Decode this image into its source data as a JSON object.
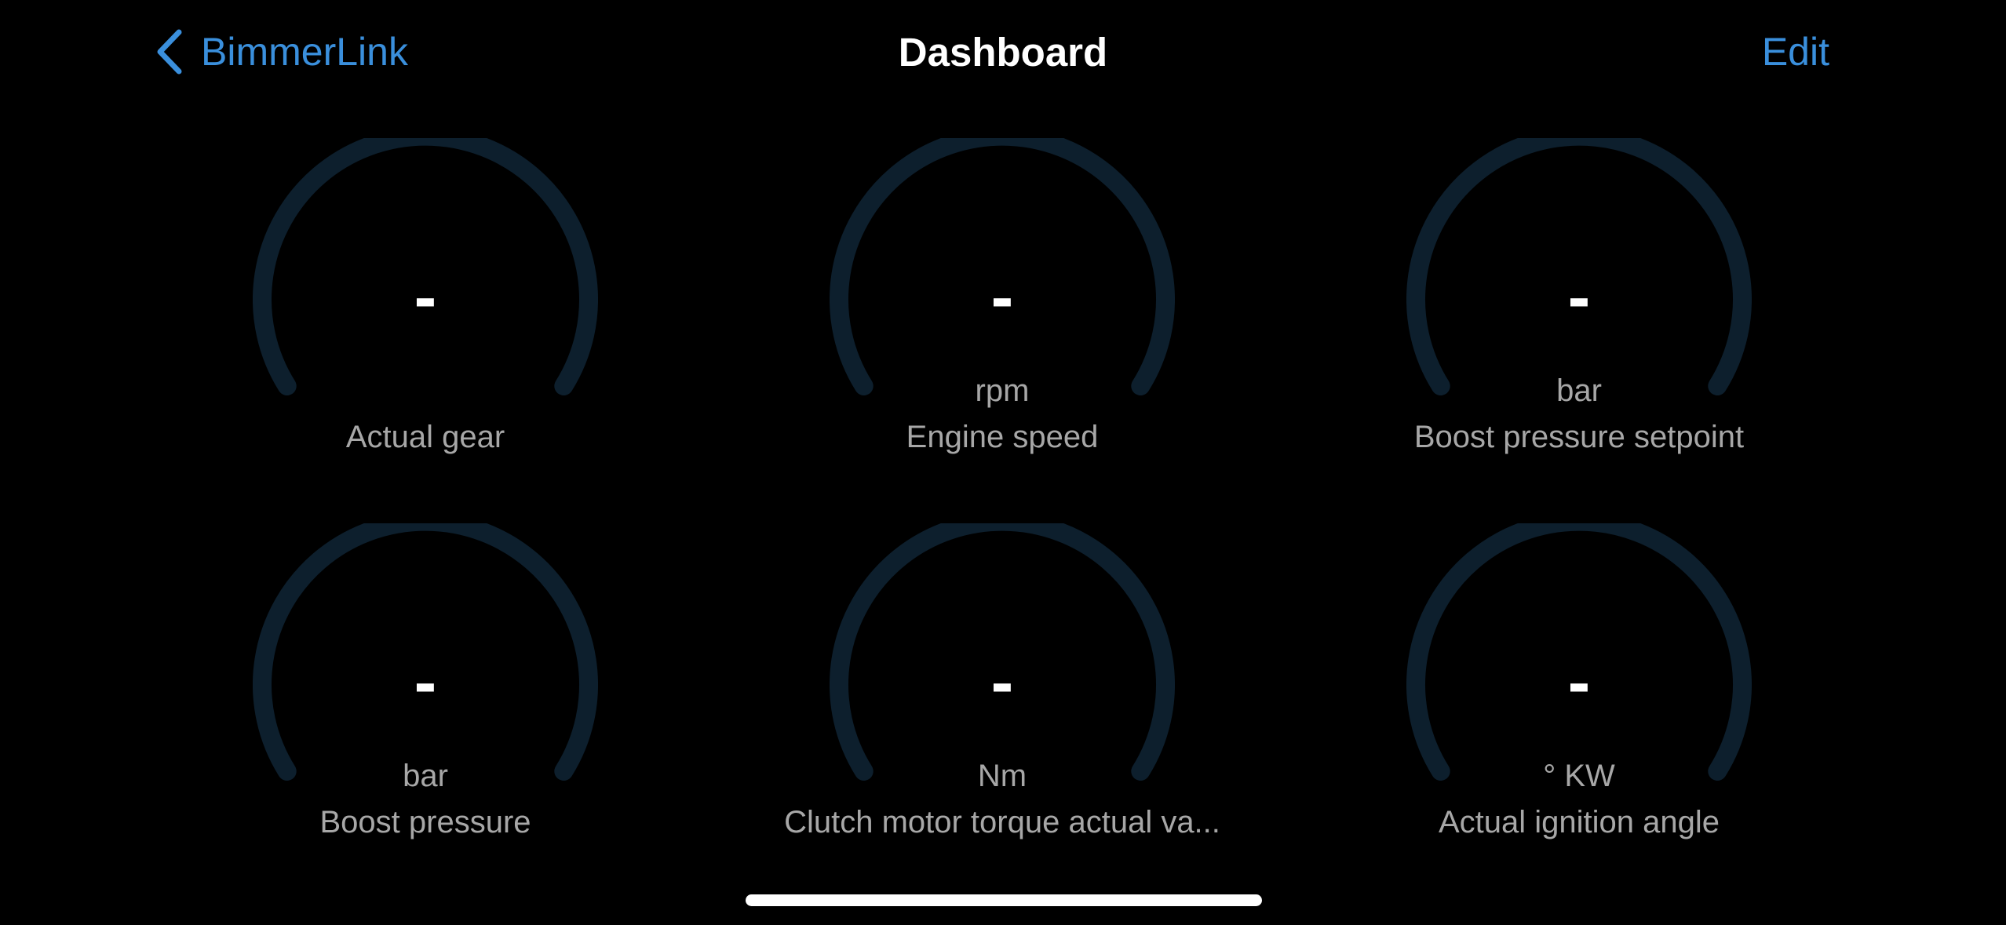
{
  "nav": {
    "back_label": "BimmerLink",
    "title": "Dashboard",
    "edit_label": "Edit",
    "back_icon": "chevron-left-icon"
  },
  "colors": {
    "accent": "#3a8fdc",
    "gauge_track": "#0d1f2d",
    "secondary_text": "#a7a7a7",
    "background": "#000000"
  },
  "gauges": [
    {
      "label": "Actual gear",
      "unit": "",
      "value": "-"
    },
    {
      "label": "Engine speed",
      "unit": "rpm",
      "value": "-"
    },
    {
      "label": "Boost pressure setpoint",
      "unit": "bar",
      "value": "-"
    },
    {
      "label": "Boost pressure",
      "unit": "bar",
      "value": "-"
    },
    {
      "label": "Clutch motor torque actual va...",
      "unit": "Nm",
      "value": "-"
    },
    {
      "label": "Actual ignition angle",
      "unit": "° KW",
      "value": "-"
    }
  ]
}
